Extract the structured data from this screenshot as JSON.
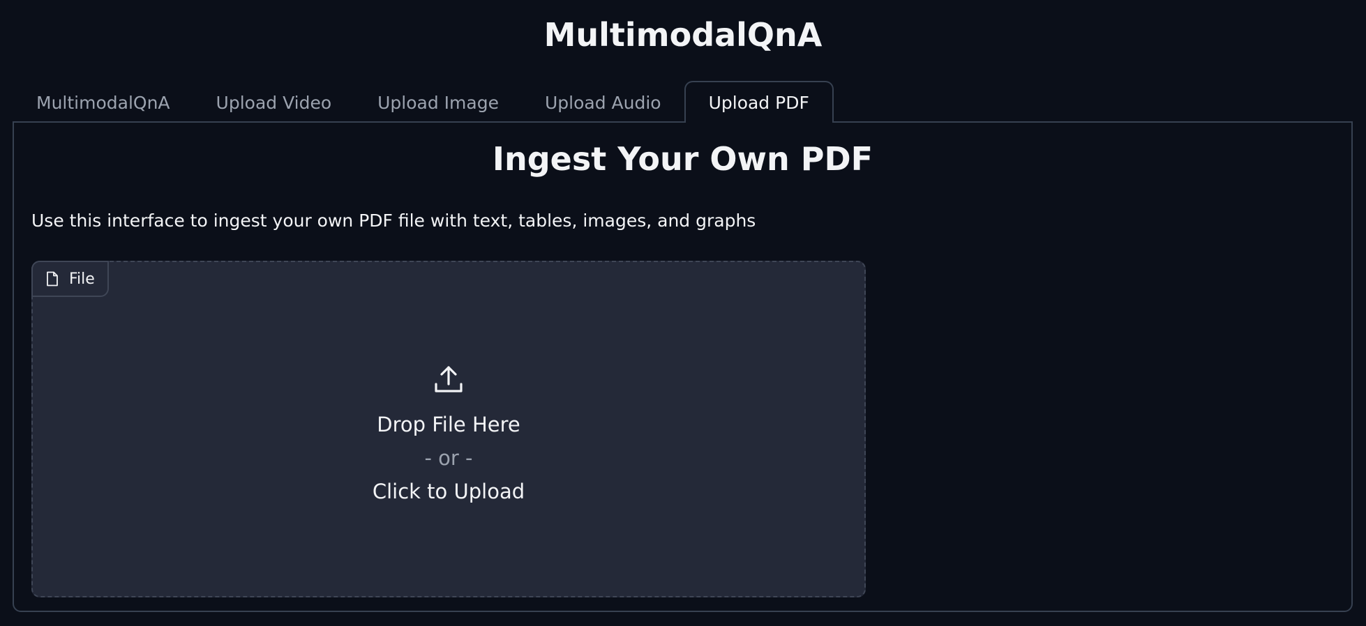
{
  "app": {
    "title": "MultimodalQnA"
  },
  "tabs": [
    {
      "label": "MultimodalQnA",
      "active": false
    },
    {
      "label": "Upload Video",
      "active": false
    },
    {
      "label": "Upload Image",
      "active": false
    },
    {
      "label": "Upload Audio",
      "active": false
    },
    {
      "label": "Upload PDF",
      "active": true
    }
  ],
  "panel": {
    "heading": "Ingest Your Own PDF",
    "description": "Use this interface to ingest your own PDF file with text, tables, images, and graphs"
  },
  "file_upload": {
    "label": "File",
    "label_icon": "file-icon",
    "upload_icon": "upload-icon",
    "drop_text": "Drop File Here",
    "or_text": "- or -",
    "click_text": "Click to Upload"
  },
  "colors": {
    "background": "#0b0f19",
    "dropzone": "#242938",
    "border": "#374151",
    "muted_text": "#9ca3af",
    "text": "#f3f4f6"
  }
}
